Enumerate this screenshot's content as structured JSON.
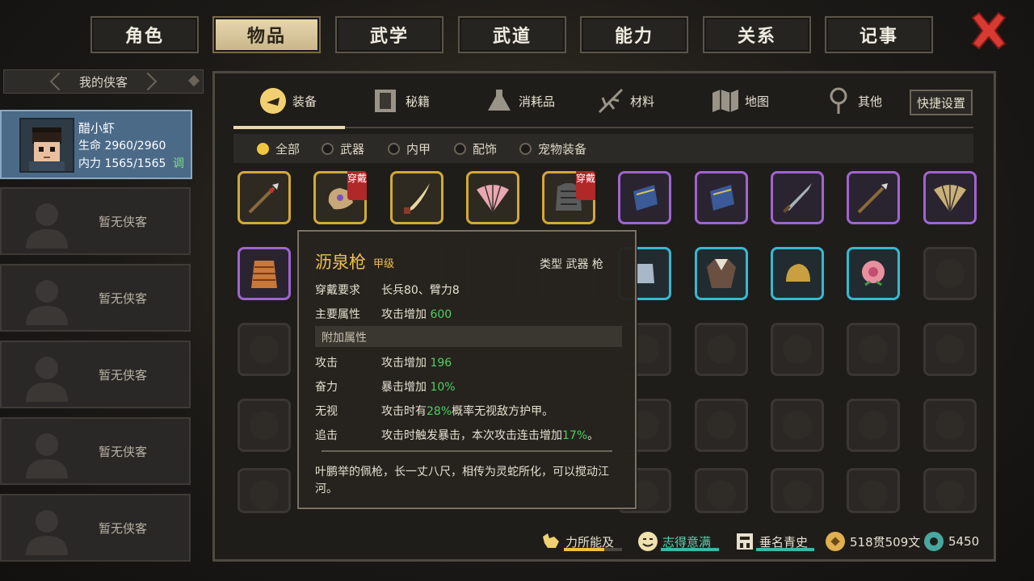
{
  "tabs": [
    "角色",
    "物品",
    "武学",
    "武道",
    "能力",
    "关系",
    "记事"
  ],
  "active_tab": 1,
  "sidebar": {
    "title": "我的侠客",
    "character": {
      "name": "醋小虾",
      "hp_label": "生命",
      "hp": "2960/2960",
      "mp_label": "内力",
      "mp": "1565/1565",
      "adjust": "调"
    },
    "empty_slots": [
      "暂无侠客",
      "暂无侠客",
      "暂无侠客",
      "暂无侠客",
      "暂无侠客"
    ]
  },
  "categories": [
    {
      "label": "装备",
      "icon": "equipment-icon"
    },
    {
      "label": "秘籍",
      "icon": "manual-book-icon"
    },
    {
      "label": "消耗品",
      "icon": "potion-icon"
    },
    {
      "label": "材料",
      "icon": "herb-icon"
    },
    {
      "label": "地图",
      "icon": "map-icon"
    },
    {
      "label": "其他",
      "icon": "misc-icon"
    }
  ],
  "quick_settings": "快捷设置",
  "filters": [
    "全部",
    "武器",
    "内甲",
    "配饰",
    "宠物装备"
  ],
  "worn_badge": "穿戴",
  "tooltip": {
    "name": "沥泉枪",
    "grade": "甲级",
    "type": "类型  武器 枪",
    "req_label": "穿戴要求",
    "req": "长兵80、臂力8",
    "main_label": "主要属性",
    "main_text": "攻击增加 ",
    "main_val": "600",
    "extra_header": "附加属性",
    "attack_label": "攻击",
    "attack_text": "攻击增加 ",
    "attack_val": "196",
    "fenli_label": "奋力",
    "fenli_text": "暴击增加 ",
    "fenli_val": "10%",
    "wushi_label": "无视",
    "wushi_pre": "攻击时有",
    "wushi_val": "28%",
    "wushi_post": "概率无视敌方护甲。",
    "zhuiji_label": "追击",
    "zhuiji_pre": "攻击时触发暴击，本次攻击连击增加",
    "zhuiji_val": "17%",
    "zhuiji_post": "。",
    "description": "叶鹏举的佩枪，长一丈八尺，相传为灵蛇所化，可以搅动江河。"
  },
  "status": {
    "strength": "力所能及",
    "mood": "志得意满",
    "fame": "垂名青史",
    "money": "518贯509文",
    "gems": "5450"
  },
  "colors": {
    "gold": "#d4a838",
    "purple": "#a064d0",
    "cyan": "#38b8d0",
    "green": "#4cd060",
    "worn": "#b02828"
  }
}
